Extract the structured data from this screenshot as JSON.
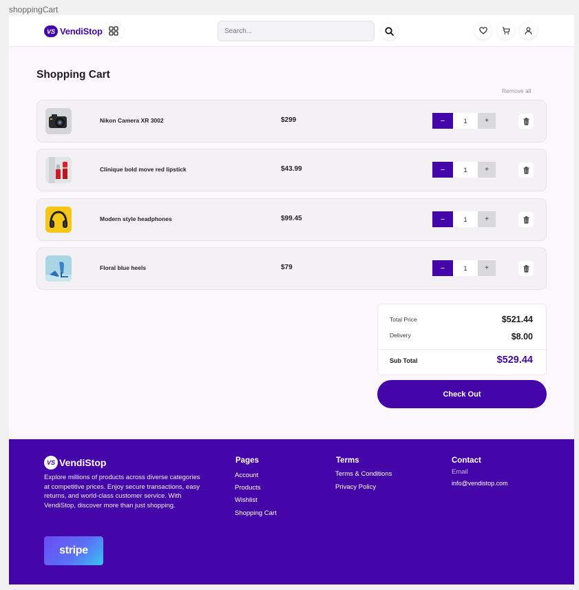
{
  "frame_label": "shoppingCart",
  "header": {
    "logo_badge": "VS",
    "logo_text": "VendiStop",
    "search_placeholder": "Search..."
  },
  "cart": {
    "title": "Shopping Cart",
    "remove_all": "Remove all",
    "items": [
      {
        "name": "Nikon Camera XR 3002",
        "price": "$299",
        "qty": "1",
        "minus": "−",
        "plus": "+"
      },
      {
        "name": "Clinique bold move red lipstick",
        "price": "$43.99",
        "qty": "1",
        "minus": "−",
        "plus": "+"
      },
      {
        "name": "Modern style headphones",
        "price": "$99.45",
        "qty": "1",
        "minus": "−",
        "plus": "+"
      },
      {
        "name": "Floral blue heels",
        "price": "$79",
        "qty": "1",
        "minus": "−",
        "plus": "+"
      }
    ]
  },
  "summary": {
    "total_price_label": "Total Price",
    "total_price_value": "$521.44",
    "delivery_label": "Delivery",
    "delivery_value": "$8.00",
    "sub_total_label": "Sub Total",
    "sub_total_value": "$529.44",
    "checkout_label": "Check Out"
  },
  "footer": {
    "logo_badge": "VS",
    "logo_text": "VendiStop",
    "description": "Explore millions of products across diverse categories at competitive prices. Enjoy secure transactions, easy returns, and world-class customer service. With VendiStop, discover more than just shopping.",
    "payment_logo": "stripe",
    "pages": {
      "heading": "Pages",
      "links": [
        "Account",
        "Products",
        "Wishlist",
        "Shopping Cart"
      ]
    },
    "terms": {
      "heading": "Terms",
      "links": [
        "Terms & Conditions",
        "Privacy Policy"
      ]
    },
    "contact": {
      "heading": "Contact",
      "email_label": "Email",
      "email": "info@vendistop.com"
    }
  },
  "colors": {
    "brand": "#4406a8",
    "page_bg": "#fbf7fd",
    "row_bg": "#f3f1f4"
  }
}
